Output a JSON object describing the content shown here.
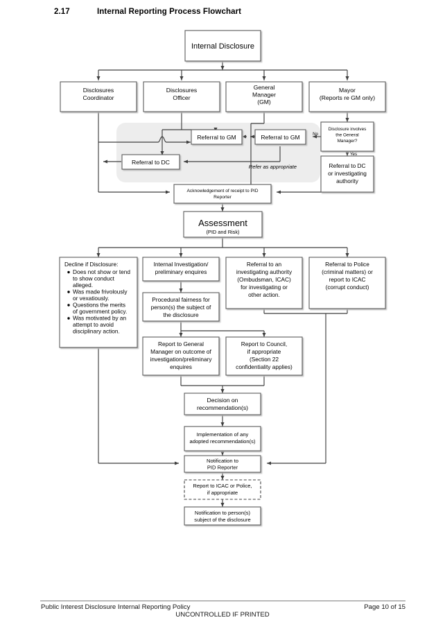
{
  "heading": {
    "number": "2.17",
    "title": "Internal Reporting Process Flowchart"
  },
  "colors": {
    "box_border": "#5a5a5a",
    "box_fill": "#ffffff",
    "line": "#3f3f3f",
    "zone_fill": "#ededed",
    "zone_label": "#6b6b6b",
    "page_background": "#ffffff",
    "footer_rule": "#7d7d7d"
  },
  "zone": {
    "label": "Refer as appropriate"
  },
  "nodes": {
    "internal_disclosure": "Internal Disclosure",
    "disclosures_coordinator": [
      "Disclosures",
      "Coordinator"
    ],
    "disclosures_officer": [
      "Disclosures",
      "Officer"
    ],
    "general_manager": [
      "General",
      "Manager",
      "(GM)"
    ],
    "mayor": [
      "Mayor",
      "(Reports re GM only)"
    ],
    "referral_to_gm_left": "Referral to GM",
    "referral_to_gm_right": "Referral to GM",
    "referral_to_dc": "Referral to DC",
    "decision_gm": [
      "Disclosure involves",
      "the General",
      "Manager?"
    ],
    "referral_to_dc_or_authority": [
      "Referral to DC",
      "or investigating",
      "authority"
    ],
    "acknowledgement": [
      "Acknowledgement of receipt to PID",
      "Reporter"
    ],
    "assessment_title": "Assessment",
    "assessment_sub": "(PID and Risk)",
    "decline_heading": "Decline if Disclosure:",
    "decline_bullets": [
      [
        "Does not show or tend",
        "to show conduct",
        "alleged."
      ],
      [
        "Was made frivolously",
        "or vexatiously."
      ],
      [
        "Questions the merits",
        "of government policy."
      ],
      [
        "Was motivated by an",
        "attempt to avoid",
        "disciplinary action."
      ]
    ],
    "internal_investigation": [
      "Internal Investigation/",
      "preliminary enquires"
    ],
    "procedural_fairness": [
      "Procedural fairness for",
      "person(s) the subject of",
      "the disclosure"
    ],
    "referral_investigating_authority": [
      "Referral to an",
      "investigating authority",
      "(Ombudsman, ICAC)",
      "for investigating or",
      "other action."
    ],
    "referral_police": [
      "Referral to Police",
      "(criminal matters) or",
      "report to ICAC",
      "(corrupt conduct)"
    ],
    "report_to_gm": [
      "Report to General",
      "Manager on outcome of",
      "investigation/preliminary",
      "enquires"
    ],
    "report_to_council": [
      "Report to Council,",
      "if appropriate",
      "(Section 22",
      "confidentiality applies)"
    ],
    "decision_on_recommendations": [
      "Decision on",
      "recommendation(s)"
    ],
    "implementation": [
      "Implementation of any",
      "adopted recommendation(s)"
    ],
    "notification_pid": [
      "Notification to",
      "PID Reporter"
    ],
    "report_icac_police": [
      "Report to ICAC or Police,",
      "if appropriate"
    ],
    "notification_person": [
      "Notification to person(s)",
      "subject of the disclosure"
    ]
  },
  "edge_labels": {
    "no": "No",
    "yes": "Yes"
  },
  "footer": {
    "left": "Public Interest Disclosure Internal Reporting Policy",
    "right": "Page 10 of 15",
    "center": "UNCONTROLLED IF PRINTED"
  }
}
